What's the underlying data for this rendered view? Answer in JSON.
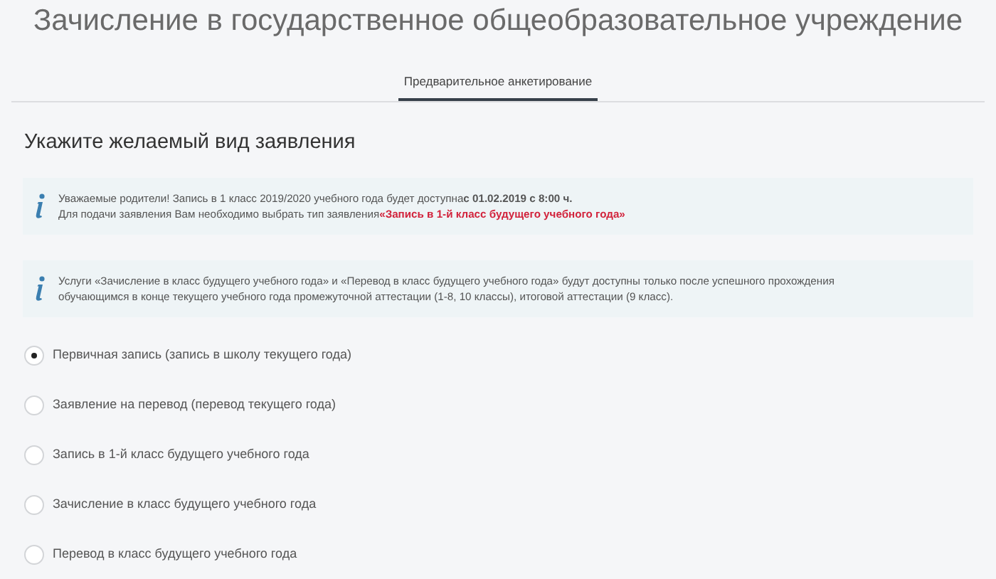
{
  "title": "Зачисление в государственное общеобразовательное учреждение",
  "tabs": [
    {
      "label": "Предварительное анкетирование",
      "selected": true
    }
  ],
  "heading": "Укажите желаемый вид заявления",
  "notices": [
    {
      "lines": [
        "Уважаемые родители! Запись в 1 класс 2019/2020 учебного года будет доступна**с 01.02.2019 с 8:00 ч.**",
        "Для подачи заявления Вам необходимо выбрать тип заявления"
      ],
      "highlight": "«Запись в 1-й класс будущего учебного года»"
    },
    {
      "lines": [
        "Услуги «Зачисление в класс будущего учебного года» и «Перевод в класс будущего учебного года» будут доступны только после успешного прохождения",
        "обучающимся в конце текущего учебного года промежуточной аттестации (1-8, 10 классы), итоговой аттестации (9 класс)."
      ]
    }
  ],
  "options": [
    {
      "label": "Первичная запись (запись в школу текущего года)",
      "selected": true
    },
    {
      "label": "Заявление на перевод (перевод текущего года)",
      "selected": false
    },
    {
      "label": "Запись в 1-й класс будущего учебного года",
      "selected": false
    },
    {
      "label": "Зачисление в класс будущего учебного года",
      "selected": false
    },
    {
      "label": "Перевод в класс будущего учебного года",
      "selected": false
    }
  ]
}
